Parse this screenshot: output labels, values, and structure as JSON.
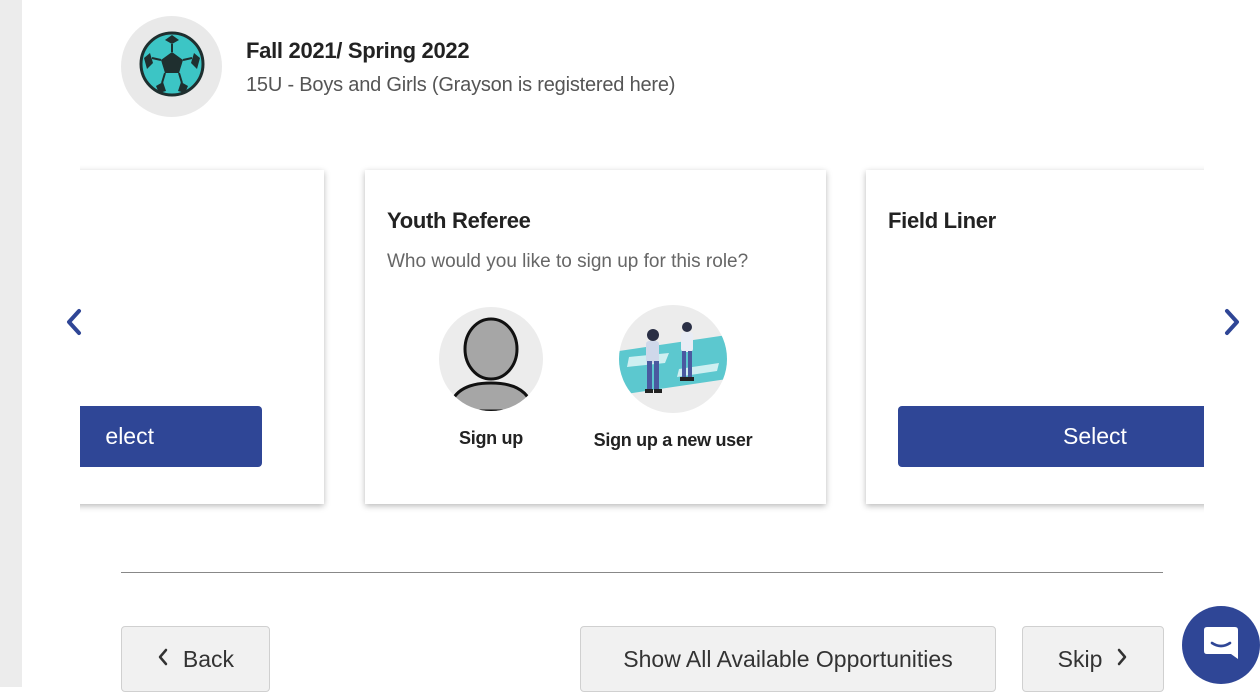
{
  "program": {
    "title": "Fall 2021/ Spring 2022",
    "subtitle": "15U - Boys and Girls (Grayson is registered here)",
    "logo_icon": "soccer-ball-icon"
  },
  "cards": {
    "left": {
      "select_label": "elect"
    },
    "center": {
      "title": "Youth Referee",
      "question": "Who would you like to sign up for this role?",
      "options": [
        {
          "label": "Sign up",
          "icon": "person-avatar-icon"
        },
        {
          "label": "Sign up a new user",
          "icon": "new-user-illustration-icon"
        }
      ]
    },
    "right": {
      "title": "Field Liner",
      "select_label": "Select"
    }
  },
  "nav": {
    "prev_icon": "chevron-left-icon",
    "next_icon": "chevron-right-icon"
  },
  "footer": {
    "back_label": "Back",
    "show_all_label": "Show All Available Opportunities",
    "skip_label": "Skip"
  },
  "colors": {
    "primary": "#2f4696",
    "accent_ball": "#3cc5c5"
  },
  "chat": {
    "icon": "chat-bubble-icon"
  }
}
